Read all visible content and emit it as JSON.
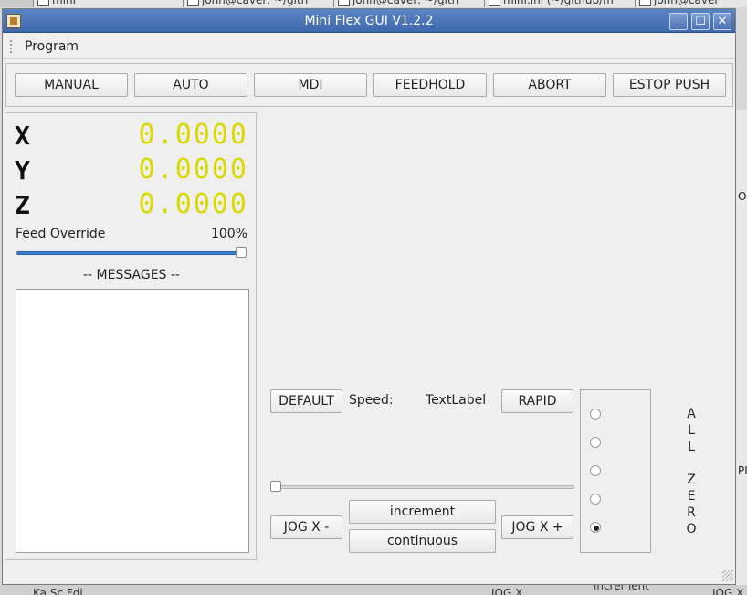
{
  "background": {
    "taskbar_tabs": [
      "mini",
      "john@caver: ~/gith",
      "john@caver: ~/gith",
      "mini.ini (~/github/m",
      "john@caver"
    ],
    "right_edge_labels": [
      "O",
      "PI"
    ],
    "bottom_labels": [
      "Ka Sc Fdi",
      "JOG X",
      "increment",
      "JOG X"
    ]
  },
  "window": {
    "title": "Mini Flex GUI V1.2.2",
    "controls": {
      "minimize": "_",
      "maximize": "☐",
      "close": "✕"
    }
  },
  "menu": {
    "program": "Program"
  },
  "toolbar": {
    "buttons": [
      "MANUAL",
      "AUTO",
      "MDI",
      "FEEDHOLD",
      "ABORT",
      "ESTOP PUSH"
    ]
  },
  "dro": {
    "axes": [
      {
        "name": "X",
        "value": "0.0000"
      },
      {
        "name": "Y",
        "value": "0.0000"
      },
      {
        "name": "Z",
        "value": "0.0000"
      }
    ],
    "value_color": "#d9d900",
    "feed_override": {
      "label": "Feed Override",
      "value": "100%",
      "level": 1.0
    },
    "messages_label": "-- MESSAGES --"
  },
  "jog": {
    "default_button": "DEFAULT",
    "speed_label": "Speed:",
    "speed_value": "TextLabel",
    "rapid_button": "RAPID",
    "slider_level": 0.0,
    "jog_minus": "JOG X -",
    "jog_plus": "JOG X +",
    "increment_button": "increment",
    "continuous_button": "continuous",
    "increment_options_selected_index": 4,
    "all_zero_letters": [
      "A",
      "L",
      "L",
      "",
      "Z",
      "E",
      "R",
      "O"
    ]
  },
  "colors": {
    "titlebar": "#4a75b8",
    "slider_fill": "#3d7fcf"
  }
}
